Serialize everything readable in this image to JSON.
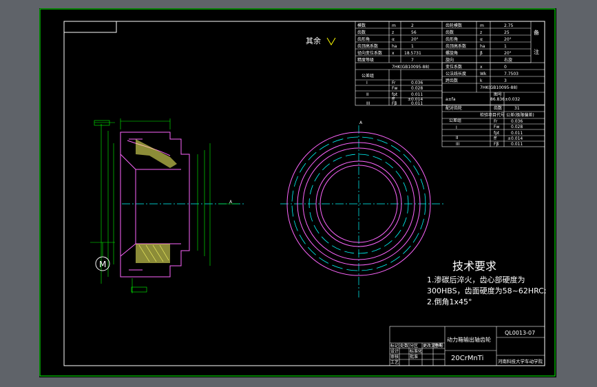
{
  "colors": {
    "background": "#5f6369",
    "sheet": "#000000",
    "frame": "#00ff00",
    "text": "#ffffff",
    "outline": "#ff66ff",
    "centerline": "#00ffff"
  },
  "drawing": {
    "roughness_note": "其余",
    "material": "20CrMnTi",
    "title": "动力箱输出轴齿轮",
    "drawing_number": "QL0013-07",
    "school": "河南科技大学车动学院",
    "datum_label": "A",
    "symbol_label": "M"
  },
  "technical_requirements": {
    "heading": "技术要求",
    "lines": [
      "1.渗碳后淬火，齿心部硬度为",
      "300HBS，齿面硬度为58~62HRC;",
      "2.倒角1x45°"
    ]
  },
  "gear_table": {
    "side_label": [
      "备",
      "注"
    ],
    "rows": [
      [
        "模数",
        "m",
        "2",
        "齿轮模数",
        "m",
        "2.75"
      ],
      [
        "齿数",
        "z",
        "56",
        "齿数",
        "z",
        "25"
      ],
      [
        "齿形角",
        "α",
        "20°",
        "齿形角",
        "α",
        "20°"
      ],
      [
        "齿顶高系数",
        "ha",
        "1",
        "齿顶高系数",
        "ha",
        "1"
      ],
      [
        "径向变位系数",
        "x",
        "18.5731",
        "螺旋角",
        "β",
        "20°"
      ],
      [
        "精度等级",
        "",
        "7",
        "旋向",
        "",
        "右旋"
      ]
    ],
    "standard": "7HK(GB10095-88)",
    "group_label": "公差组",
    "groups": [
      {
        "group": "I",
        "sym": "Fr",
        "value": "0.036"
      },
      {
        "group": "",
        "sym": "Fw",
        "value": "0.028"
      },
      {
        "group": "II",
        "sym": "fpt",
        "value": "0.011"
      },
      {
        "group": "",
        "sym": "ff",
        "value": "±0.014"
      },
      {
        "group": "III",
        "sym": "Fβ",
        "value": "0.011"
      }
    ]
  },
  "right_table": {
    "rows": [
      [
        "变位系数",
        "x",
        "0"
      ],
      [
        "公法线长度",
        "Wk",
        "7.7503"
      ],
      [
        "跨齿数",
        "k",
        "3"
      ]
    ],
    "standard": "7HK(GB10095-88)",
    "center_distance_label": "a±fa",
    "center_distance_value": "86.836±0.032",
    "mating_label": "配对齿轮",
    "mating_rows": [
      [
        "图号",
        ""
      ],
      [
        "齿数",
        "31"
      ]
    ],
    "check_label": "检验项目代号",
    "check_value": "公差(极限偏差)",
    "group_label": "公差组",
    "groups": [
      {
        "group": "I",
        "sym": "Fr",
        "value": "0.036"
      },
      {
        "group": "",
        "sym": "Fw",
        "value": "0.028"
      },
      {
        "group": "II",
        "sym": "fpt",
        "value": "0.011"
      },
      {
        "group": "",
        "sym": "ff",
        "value": "±0.014"
      },
      {
        "group": "III",
        "sym": "Fβ",
        "value": "0.011"
      }
    ]
  },
  "title_block_labels": [
    "标记",
    "处数",
    "分区",
    "更改文件号",
    "签名",
    "年月日",
    "设计",
    "审核",
    "工艺",
    "标准化",
    "批准"
  ]
}
